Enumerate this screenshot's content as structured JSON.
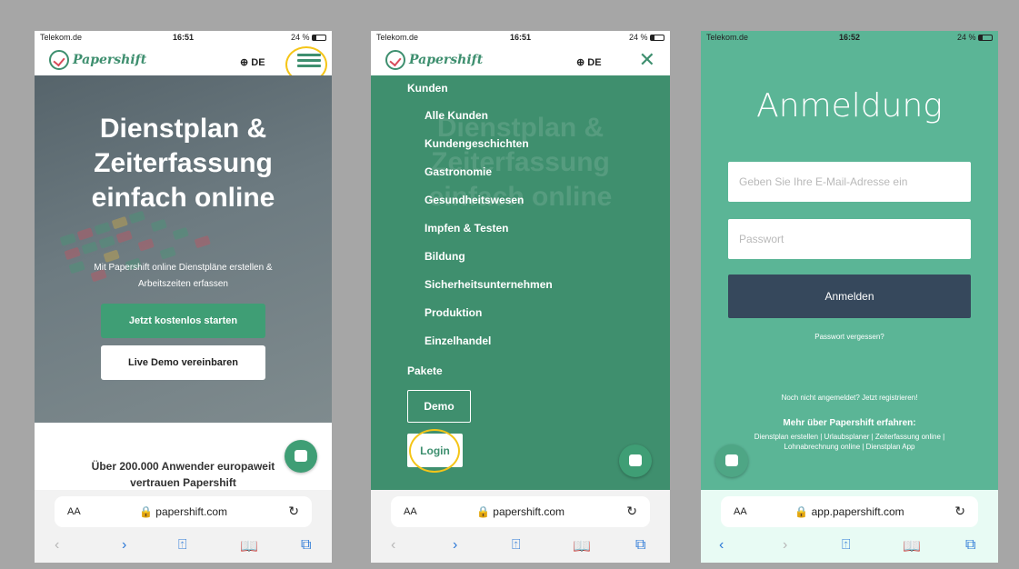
{
  "statusbars": {
    "p1": {
      "carrier": "Telekom.de",
      "time": "16:51",
      "battery": "24 %"
    },
    "p2": {
      "carrier": "Telekom.de",
      "time": "16:51",
      "battery": "24 %"
    },
    "p3": {
      "carrier": "Telekom.de",
      "time": "16:52",
      "battery": "24 %"
    }
  },
  "header": {
    "logo_text": "Papershift",
    "language": "DE"
  },
  "screen1": {
    "hero_title_l1": "Dienstplan &",
    "hero_title_l2": "Zeiterfassung",
    "hero_title_l3": "einfach online",
    "hero_sub_l1": "Mit Papershift online Dienstpläne erstellen &",
    "hero_sub_l2": "Arbeitszeiten erfassen",
    "cta_primary": "Jetzt kostenlos starten",
    "cta_secondary": "Live Demo vereinbaren",
    "section_l1": "Über 200.000 Anwender europaweit",
    "section_l2": "vertrauen Papershift"
  },
  "screen2": {
    "menu_section": "Kunden",
    "menu_items": [
      "Alle Kunden",
      "Kundengeschichten",
      "Gastronomie",
      "Gesundheitswesen",
      "Impfen & Testen",
      "Bildung",
      "Sicherheitsunternehmen",
      "Produktion",
      "Einzelhandel"
    ],
    "pakete": "Pakete",
    "demo": "Demo",
    "login": "Login"
  },
  "screen3": {
    "title": "Anmeldung",
    "email_placeholder": "Geben Sie Ihre E-Mail-Adresse ein",
    "password_placeholder": "Passwort",
    "submit": "Anmelden",
    "forgot": "Passwort vergessen?",
    "register": "Noch nicht angemeldet? Jetzt registrieren!",
    "more_title": "Mehr über Papershift erfahren:",
    "links_l1": "Dienstplan erstellen | Urlaubsplaner | Zeiterfassung online |",
    "links_l2": "Lohnabrechnung online | Dienstplan App"
  },
  "browser": {
    "aa": "AA",
    "url1": "papershift.com",
    "url2": "papershift.com",
    "url3": "app.papershift.com",
    "reload": "↻",
    "back": "‹",
    "forward": "›",
    "share": "⍐",
    "bookmarks": "📖",
    "tabs": "⧉"
  },
  "colors": {
    "brand_green": "#3e8f6f",
    "highlight": "#f5c518",
    "login_bg": "#5bb596",
    "button_dark": "#36485c"
  }
}
